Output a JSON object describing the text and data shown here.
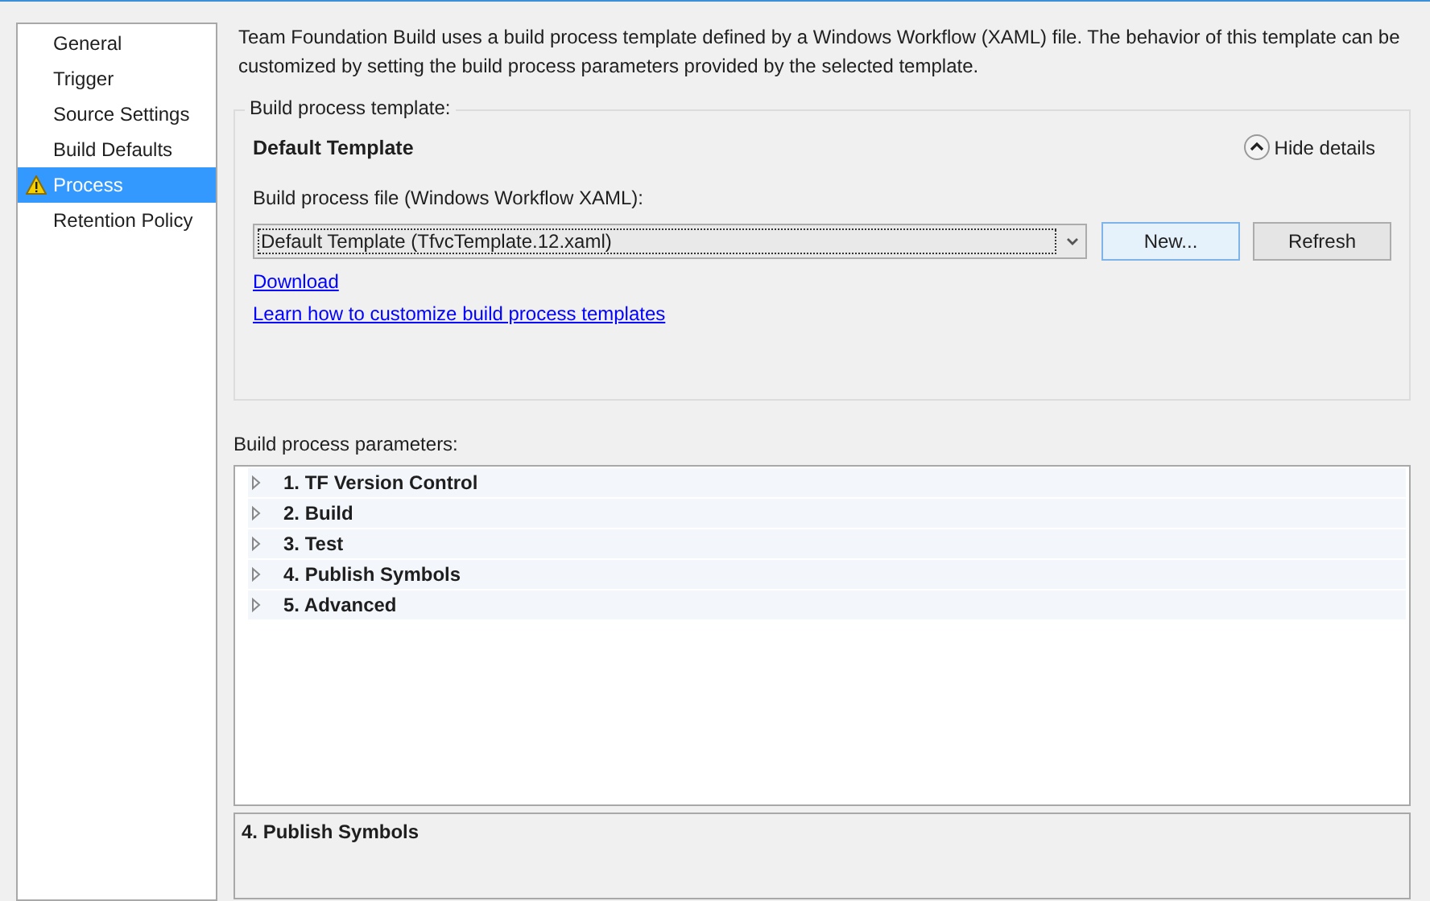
{
  "sidebar": {
    "items": [
      {
        "label": "General",
        "selected": false,
        "warning": false
      },
      {
        "label": "Trigger",
        "selected": false,
        "warning": false
      },
      {
        "label": "Source Settings",
        "selected": false,
        "warning": false
      },
      {
        "label": "Build Defaults",
        "selected": false,
        "warning": false
      },
      {
        "label": "Process",
        "selected": true,
        "warning": true
      },
      {
        "label": "Retention Policy",
        "selected": false,
        "warning": false
      }
    ]
  },
  "description": "Team Foundation Build uses a build process template defined by a Windows Workflow (XAML) file. The behavior of this template can be customized by setting the build process parameters provided by the selected template.",
  "template_group": {
    "legend": "Build process template:",
    "title": "Default Template",
    "toggle": "Hide details",
    "file_label": "Build process file (Windows Workflow XAML):",
    "file_value": "Default Template (TfvcTemplate.12.xaml)",
    "buttons": [
      {
        "label": "New...",
        "selected": true
      },
      {
        "label": "Refresh",
        "selected": false
      }
    ],
    "links": [
      "Download",
      "Learn how to customize build process templates"
    ]
  },
  "parameters": {
    "label": "Build process parameters:",
    "items": [
      {
        "label": "1. TF Version Control",
        "expanded": false
      },
      {
        "label": "2. Build",
        "expanded": false
      },
      {
        "label": "3. Test",
        "expanded": false
      },
      {
        "label": "4. Publish Symbols",
        "expanded": false
      },
      {
        "label": "5. Advanced",
        "expanded": false
      }
    ]
  },
  "details": {
    "title": "4. Publish Symbols"
  }
}
